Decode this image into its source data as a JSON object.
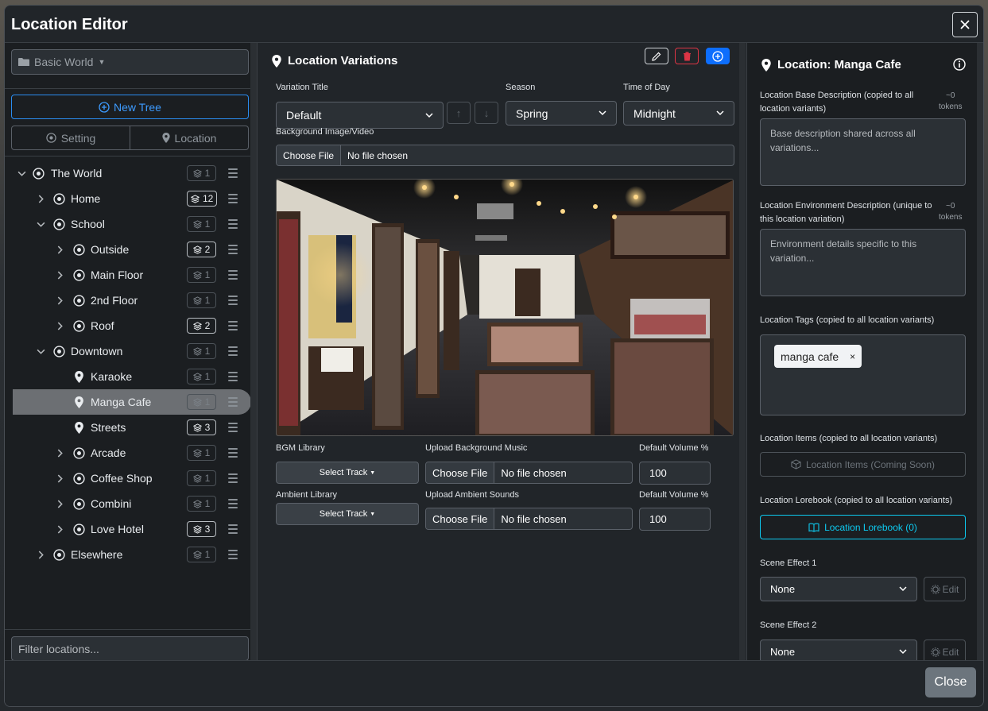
{
  "modal": {
    "title": "Location Editor",
    "close_label": "Close"
  },
  "left": {
    "world_select": "Basic World",
    "new_tree_label": "New Tree",
    "tabs": [
      {
        "label": "Setting"
      },
      {
        "label": "Location"
      }
    ],
    "filter_placeholder": "Filter locations...",
    "tree": [
      {
        "label": "The World",
        "count": "1",
        "level": 0,
        "chevron": "down",
        "icon": "crosshair",
        "count_active": false,
        "selected": false
      },
      {
        "label": "Home",
        "count": "12",
        "level": 1,
        "chevron": "right",
        "icon": "crosshair",
        "count_active": true,
        "selected": false
      },
      {
        "label": "School",
        "count": "1",
        "level": 1,
        "chevron": "down",
        "icon": "crosshair",
        "count_active": false,
        "selected": false
      },
      {
        "label": "Outside",
        "count": "2",
        "level": 2,
        "chevron": "right",
        "icon": "crosshair",
        "count_active": true,
        "selected": false
      },
      {
        "label": "Main Floor",
        "count": "1",
        "level": 2,
        "chevron": "right",
        "icon": "crosshair",
        "count_active": false,
        "selected": false
      },
      {
        "label": "2nd Floor",
        "count": "1",
        "level": 2,
        "chevron": "right",
        "icon": "crosshair",
        "count_active": false,
        "selected": false
      },
      {
        "label": "Roof",
        "count": "2",
        "level": 2,
        "chevron": "right",
        "icon": "crosshair",
        "count_active": true,
        "selected": false
      },
      {
        "label": "Downtown",
        "count": "1",
        "level": 1,
        "chevron": "down",
        "icon": "crosshair",
        "count_active": false,
        "selected": false
      },
      {
        "label": "Karaoke",
        "count": "1",
        "level": 2,
        "chevron": "none",
        "icon": "pin",
        "count_active": false,
        "selected": false
      },
      {
        "label": "Manga Cafe",
        "count": "1",
        "level": 2,
        "chevron": "none",
        "icon": "pin",
        "count_active": false,
        "selected": true
      },
      {
        "label": "Streets",
        "count": "3",
        "level": 2,
        "chevron": "none",
        "icon": "pin",
        "count_active": true,
        "selected": false
      },
      {
        "label": "Arcade",
        "count": "1",
        "level": 2,
        "chevron": "right",
        "icon": "crosshair",
        "count_active": false,
        "selected": false
      },
      {
        "label": "Coffee Shop",
        "count": "1",
        "level": 2,
        "chevron": "right",
        "icon": "crosshair",
        "count_active": false,
        "selected": false
      },
      {
        "label": "Combini",
        "count": "1",
        "level": 2,
        "chevron": "right",
        "icon": "crosshair",
        "count_active": false,
        "selected": false
      },
      {
        "label": "Love Hotel",
        "count": "3",
        "level": 2,
        "chevron": "right",
        "icon": "crosshair",
        "count_active": true,
        "selected": false
      },
      {
        "label": "Elsewhere",
        "count": "1",
        "level": 1,
        "chevron": "right",
        "icon": "crosshair",
        "count_active": false,
        "selected": false
      }
    ]
  },
  "variations": {
    "title": "Location Variations",
    "variation_title_label": "Variation Title",
    "variation_value": "Default",
    "season_label": "Season",
    "season_value": "Spring",
    "time_label": "Time of Day",
    "time_value": "Midnight",
    "bg_label": "Background Image/Video",
    "choose_file": "Choose File",
    "no_file": "No file chosen",
    "bgm_library_label": "BGM Library",
    "select_track": "Select Track",
    "upload_music_label": "Upload Background Music",
    "default_volume_label": "Default Volume %",
    "bgm_volume": "100",
    "ambient_library_label": "Ambient Library",
    "upload_ambient_label": "Upload Ambient Sounds",
    "ambient_volume": "100"
  },
  "location": {
    "title": "Location: Manga Cafe",
    "base_desc_label": "Location Base Description (copied to all location variants)",
    "base_desc_placeholder": "Base description shared across all variations...",
    "env_desc_label": "Location Environment Description (unique to this location variation)",
    "env_desc_placeholder": "Environment details specific to this variation...",
    "tokens_top": "~0",
    "tokens_bottom": "tokens",
    "tags_label": "Location Tags (copied to all location variants)",
    "tags": [
      "manga cafe"
    ],
    "items_label": "Location Items (copied to all location variants)",
    "items_button": "Location Items (Coming Soon)",
    "lorebook_label": "Location Lorebook (copied to all location variants)",
    "lorebook_button": "Location Lorebook (0)",
    "scene_effect_1_label": "Scene Effect 1",
    "scene_effect_1_value": "None",
    "scene_effect_2_label": "Scene Effect 2",
    "scene_effect_2_value": "None",
    "edit_label": "Edit"
  },
  "colors": {
    "primary": "#0d6efd",
    "danger": "#dc3545",
    "info": "#0dcaf0",
    "panel": "#1b1e21",
    "modal": "#212529"
  }
}
